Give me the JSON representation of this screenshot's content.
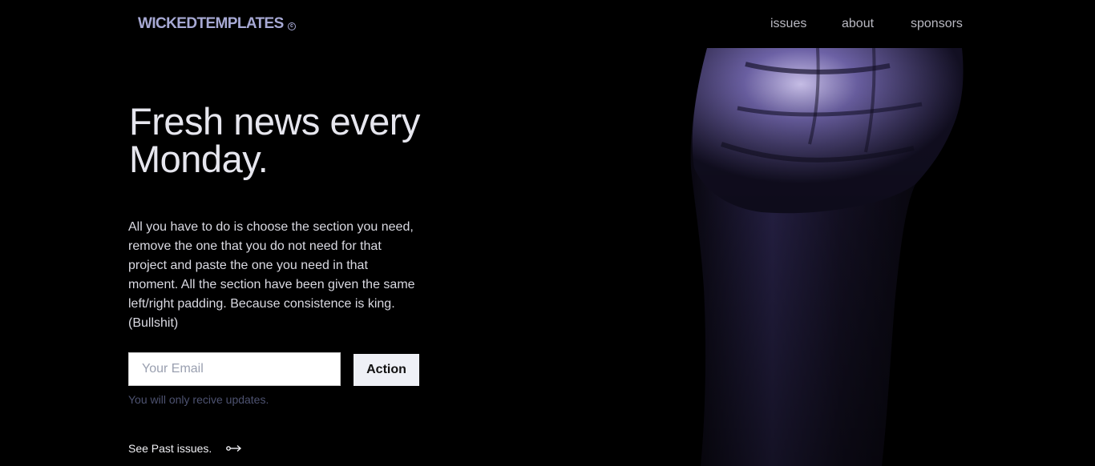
{
  "header": {
    "logo": "WICKEDTEMPLATES",
    "nav": [
      {
        "label": "issues"
      },
      {
        "label": "about"
      },
      {
        "label": "sponsors"
      }
    ]
  },
  "hero": {
    "title": "Fresh news every Monday.",
    "description": "All you have to do is choose the section you need, remove the one that you do not need for that project and paste the one you need in that moment. All the section have been given the same left/right padding. Because consistence is king. (Bullshit)"
  },
  "form": {
    "email_value": "",
    "email_placeholder": "Your Email",
    "action_label": "Action",
    "helper_text": "You will only recive updates."
  },
  "footer_link": {
    "label": "See Past issues."
  },
  "image": {
    "subject": "raised fist",
    "tint": "#8a7ec8"
  },
  "colors": {
    "background": "#000000",
    "logo": "#a7a9d4",
    "helper": "#4d5270"
  }
}
